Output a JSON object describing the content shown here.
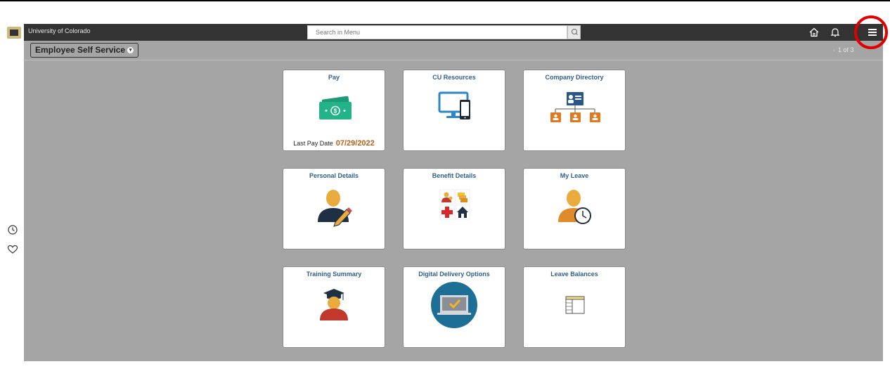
{
  "header": {
    "brand": "University of Colorado",
    "search_placeholder": "Search in Menu",
    "icons": [
      "search-icon",
      "home-icon",
      "bell-icon",
      "hamburger-menu-icon"
    ]
  },
  "sidebar": {
    "icons": [
      "recent-history-icon",
      "favorites-heart-icon"
    ]
  },
  "page": {
    "title": "Employee Self Service",
    "pager": "1 of 3"
  },
  "tiles": [
    {
      "title": "Pay",
      "icon": "cash-icon",
      "footer_label": "Last Pay Date",
      "footer_value": "07/29/2022"
    },
    {
      "title": "CU Resources",
      "icon": "computer-devices-icon"
    },
    {
      "title": "Company Directory",
      "icon": "org-chart-icon"
    },
    {
      "title": "Personal Details",
      "icon": "person-edit-icon"
    },
    {
      "title": "Benefit Details",
      "icon": "benefits-icon"
    },
    {
      "title": "My Leave",
      "icon": "person-clock-icon"
    },
    {
      "title": "Training Summary",
      "icon": "graduate-icon"
    },
    {
      "title": "Digital Delivery Options",
      "icon": "laptop-check-icon"
    },
    {
      "title": "Leave Balances",
      "icon": "table-report-icon"
    }
  ],
  "colors": {
    "navbar": "#333333",
    "content_bg": "#a5a5a5",
    "tile_title": "#2f5e8e",
    "pay_date": "#b65f17",
    "highlight": "#e00000"
  }
}
